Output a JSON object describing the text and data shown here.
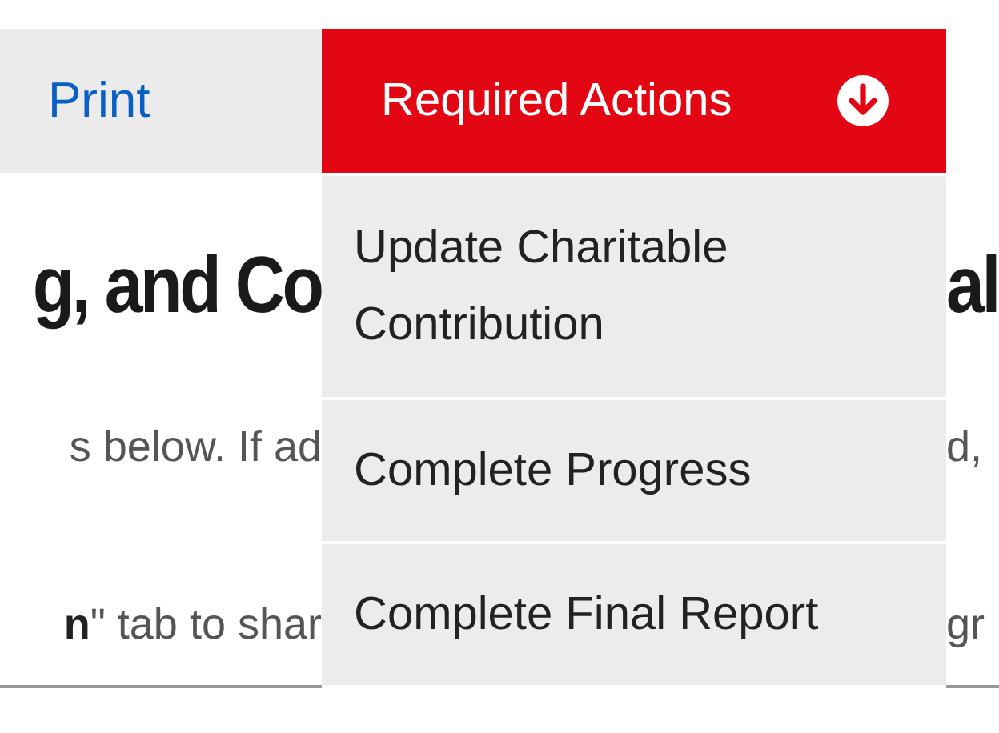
{
  "top_bar": {
    "link": "Print"
  },
  "required_actions": {
    "label": "Required Actions",
    "items": [
      {
        "label": "Update Charitable Contribution"
      },
      {
        "label": "Complete Progress"
      },
      {
        "label": "Complete Final Report"
      }
    ]
  },
  "heading": {
    "left": "g, and Co",
    "right": "al"
  },
  "paragraph_lines": [
    {
      "left": "s below. If ad",
      "right": "d,"
    },
    {
      "left": "**n**\" tab to shar",
      "right": "gr"
    }
  ]
}
